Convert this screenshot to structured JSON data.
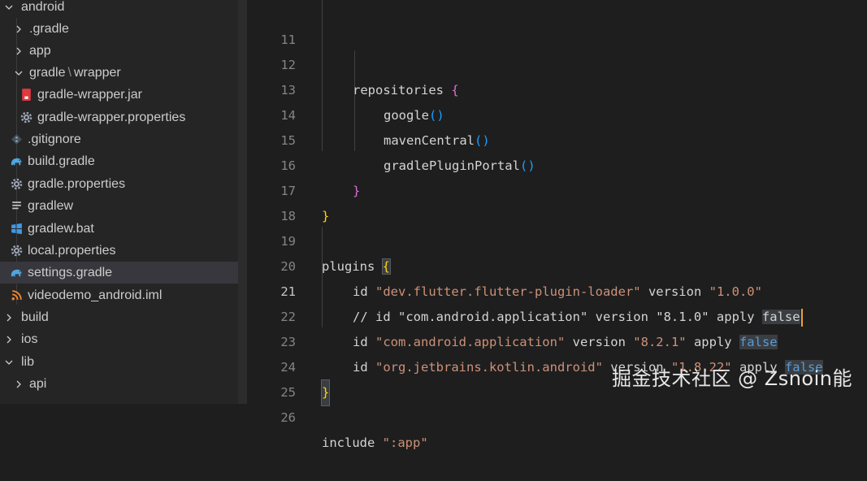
{
  "explorer": {
    "items": [
      {
        "label": "android",
        "type": "folder-open"
      },
      {
        "label": ".gradle",
        "type": "folder"
      },
      {
        "label": "app",
        "type": "folder"
      },
      {
        "label_a": "gradle",
        "label_b": "wrapper",
        "type": "folder-open"
      },
      {
        "label": "gradle-wrapper.jar",
        "type": "jar-icon"
      },
      {
        "label": "gradle-wrapper.properties",
        "type": "gear-icon"
      },
      {
        "label": ".gitignore",
        "type": "git-icon"
      },
      {
        "label": "build.gradle",
        "type": "gradle-elephant-icon"
      },
      {
        "label": "gradle.properties",
        "type": "gear-icon"
      },
      {
        "label": "gradlew",
        "type": "lines-icon"
      },
      {
        "label": "gradlew.bat",
        "type": "windows-icon"
      },
      {
        "label": "local.properties",
        "type": "gear-icon"
      },
      {
        "label": "settings.gradle",
        "type": "gradle-elephant-icon",
        "selected": true
      },
      {
        "label": "videodemo_android.iml",
        "type": "rss-icon"
      },
      {
        "label": "build",
        "type": "folder"
      },
      {
        "label": "ios",
        "type": "folder"
      },
      {
        "label": "lib",
        "type": "folder-open"
      },
      {
        "label": "api",
        "type": "folder"
      }
    ]
  },
  "editor": {
    "active_line": "21",
    "lines": [
      {
        "n": "11"
      },
      {
        "n": "12",
        "t1": "repositories "
      },
      {
        "n": "13",
        "t1": "google"
      },
      {
        "n": "14",
        "t1": "mavenCentral"
      },
      {
        "n": "15",
        "t1": "gradlePluginPortal"
      },
      {
        "n": "16"
      },
      {
        "n": "17"
      },
      {
        "n": "18"
      },
      {
        "n": "19",
        "t1": "plugins "
      },
      {
        "n": "20",
        "t1": "id ",
        "s1": "\"dev.flutter.flutter-plugin-loader\"",
        "t2": " version ",
        "s2": "\"1.0.0\""
      },
      {
        "n": "21",
        "t1": "// id \"com.android.application\" version \"8.1.0\" apply ",
        "k": "false"
      },
      {
        "n": "22",
        "t1": "id ",
        "s1": "\"com.android.application\"",
        "t2": " version ",
        "s2": "\"8.2.1\"",
        "t3": " apply ",
        "k": "false"
      },
      {
        "n": "23",
        "t1": "id ",
        "s1": "\"org.jetbrains.kotlin.android\"",
        "t2": " version ",
        "s2": "\"1.8.22\"",
        "t3": " apply ",
        "k": "false"
      },
      {
        "n": "24"
      },
      {
        "n": "25"
      },
      {
        "n": "26",
        "t1": "include ",
        "s1": "\":app\""
      }
    ],
    "paren": "()",
    "brace_open": "{",
    "brace_close": "}"
  },
  "watermark": "掘金技术社区 @ Zsnoin能",
  "colors": {
    "string": "#ce9178",
    "keyword": "#569cd6",
    "bracket_level1": "#ffd700",
    "bracket_level2": "#da70d6",
    "bracket_level3": "#179fff",
    "cursor": "#e8a33d"
  }
}
